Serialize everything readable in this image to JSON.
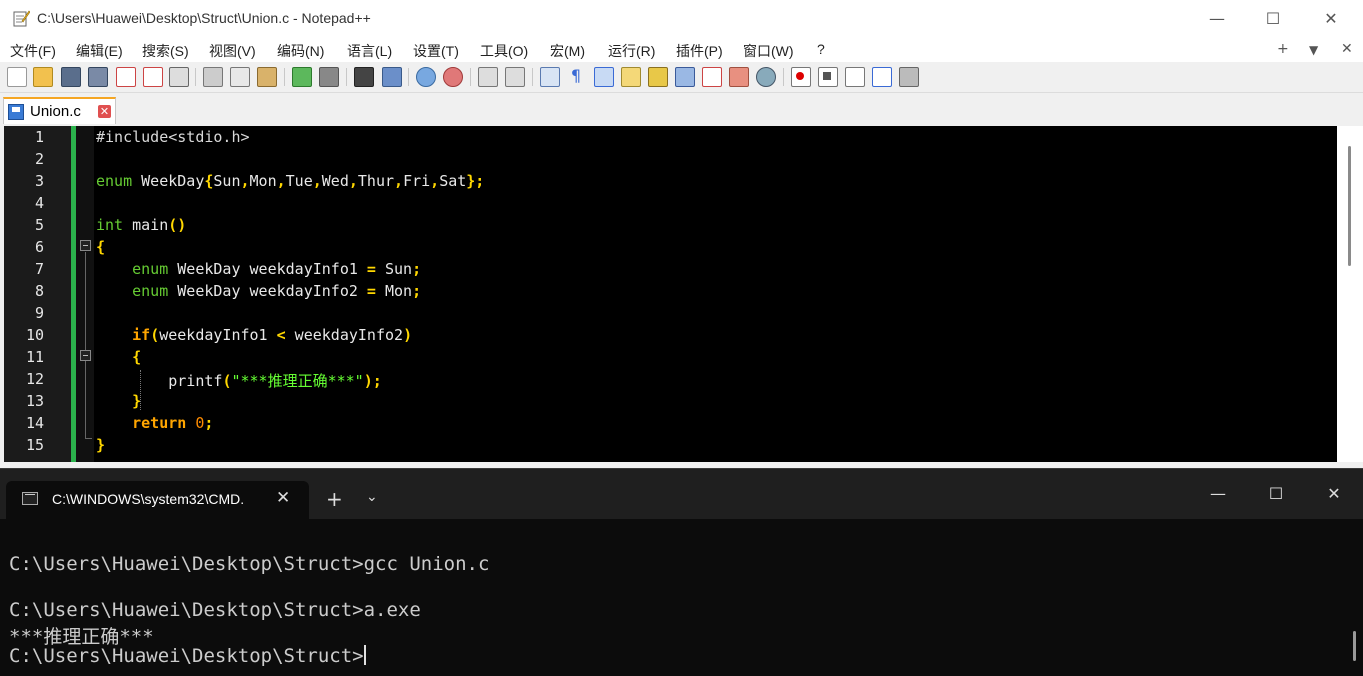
{
  "npp": {
    "title": "C:\\Users\\Huawei\\Desktop\\Struct\\Union.c - Notepad++",
    "window_controls": {
      "minimize": "—",
      "maximize": "☐",
      "close": "✕"
    },
    "menu": [
      "文件(F)",
      "编辑(E)",
      "搜索(S)",
      "视图(V)",
      "编码(N)",
      "语言(L)",
      "设置(T)",
      "工具(O)",
      "宏(M)",
      "运行(R)",
      "插件(P)",
      "窗口(W)",
      "?"
    ],
    "menu_right": {
      "add": "+",
      "dropdown": "▼",
      "close": "✕"
    },
    "tab": {
      "label": "Union.c",
      "close": "✕"
    },
    "line_numbers": [
      "1",
      "2",
      "3",
      "4",
      "5",
      "6",
      "7",
      "8",
      "9",
      "10",
      "11",
      "12",
      "13",
      "14",
      "15"
    ],
    "code": {
      "l1": "#include<stdio.h>",
      "l3_kw": "enum",
      "l3_name": " WeekDay",
      "l3_open": "{",
      "l3_vals": [
        "Sun",
        "Mon",
        "Tue",
        "Wed",
        "Thur",
        "Fri",
        "Sat"
      ],
      "l3_close": "};",
      "l5_type": "int",
      "l5_name": " main",
      "l5_parens": "()",
      "l6": "{",
      "l7_kw": "enum",
      "l7_type": " WeekDay",
      "l7_var": " weekdayInfo1",
      "l7_eq": " =",
      "l7_val": " Sun",
      "l7_semi": ";",
      "l8_kw": "enum",
      "l8_type": " WeekDay",
      "l8_var": " weekdayInfo2",
      "l8_eq": " =",
      "l8_val": " Mon",
      "l8_semi": ";",
      "l10_kw": "if",
      "l10_open": "(",
      "l10_a": "weekdayInfo1",
      "l10_op": " <",
      "l10_b": " weekdayInfo2",
      "l10_close": ")",
      "l11": "{",
      "l12_fn": "printf",
      "l12_open": "(",
      "l12_str": "\"***推理正确***\"",
      "l12_close": ");",
      "l13": "}",
      "l14_kw": "return",
      "l14_num": " 0",
      "l14_semi": ";",
      "l15": "}"
    }
  },
  "terminal": {
    "tab_label": "C:\\WINDOWS\\system32\\CMD.",
    "tab_close": "✕",
    "add": "+",
    "dropdown": "⌄",
    "window_controls": {
      "minimize": "—",
      "maximize": "☐",
      "close": "✕"
    },
    "lines": [
      "C:\\Users\\Huawei\\Desktop\\Struct>gcc Union.c",
      "",
      "C:\\Users\\Huawei\\Desktop\\Struct>a.exe",
      "***推理正确***",
      "C:\\Users\\Huawei\\Desktop\\Struct>"
    ]
  },
  "colors": {
    "editor_bg": "#000000",
    "keyword": "#66cc33",
    "control_keyword": "#ffa500",
    "operator": "#ffd700",
    "string": "#66ff33",
    "number": "#ff8c00",
    "change_bar": "#2bb24c",
    "terminal_bg": "#0c0c0c"
  }
}
